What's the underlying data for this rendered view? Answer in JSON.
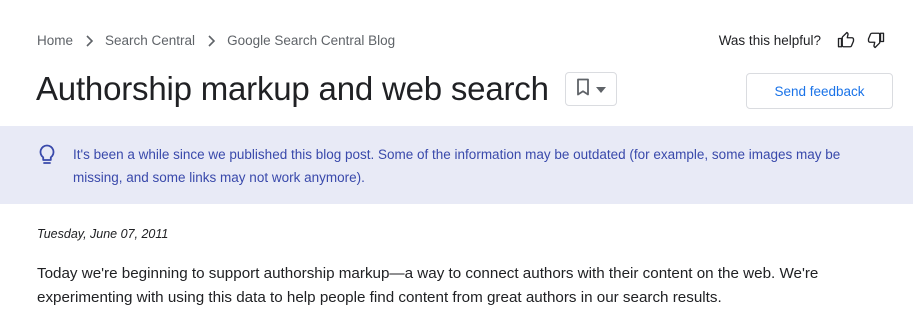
{
  "breadcrumb": {
    "items": [
      {
        "label": "Home"
      },
      {
        "label": "Search Central"
      },
      {
        "label": "Google Search Central Blog"
      }
    ]
  },
  "helpful": {
    "label": "Was this helpful?",
    "thumbs_up_icon": "thumb-up-icon",
    "thumbs_down_icon": "thumb-down-icon"
  },
  "header": {
    "title": "Authorship markup and web search",
    "bookmark_icon": "bookmark-icon",
    "dropdown_icon": "caret-down-icon",
    "feedback_label": "Send feedback"
  },
  "notice": {
    "icon": "lightbulb-icon",
    "text": "It's been a while since we published this blog post. Some of the information may be outdated (for example, some images may be missing, and some links may not work anymore)."
  },
  "post": {
    "date": "Tuesday, June 07, 2011",
    "body": "Today we're beginning to support authorship markup—a way to connect authors with their content on the web. We're experimenting with using this data to help people find content from great authors in our search results."
  },
  "colors": {
    "link_blue": "#1a73e8",
    "notice_bg": "#e8eaf6",
    "notice_text": "#3949ab",
    "muted_text": "#5f6368"
  }
}
